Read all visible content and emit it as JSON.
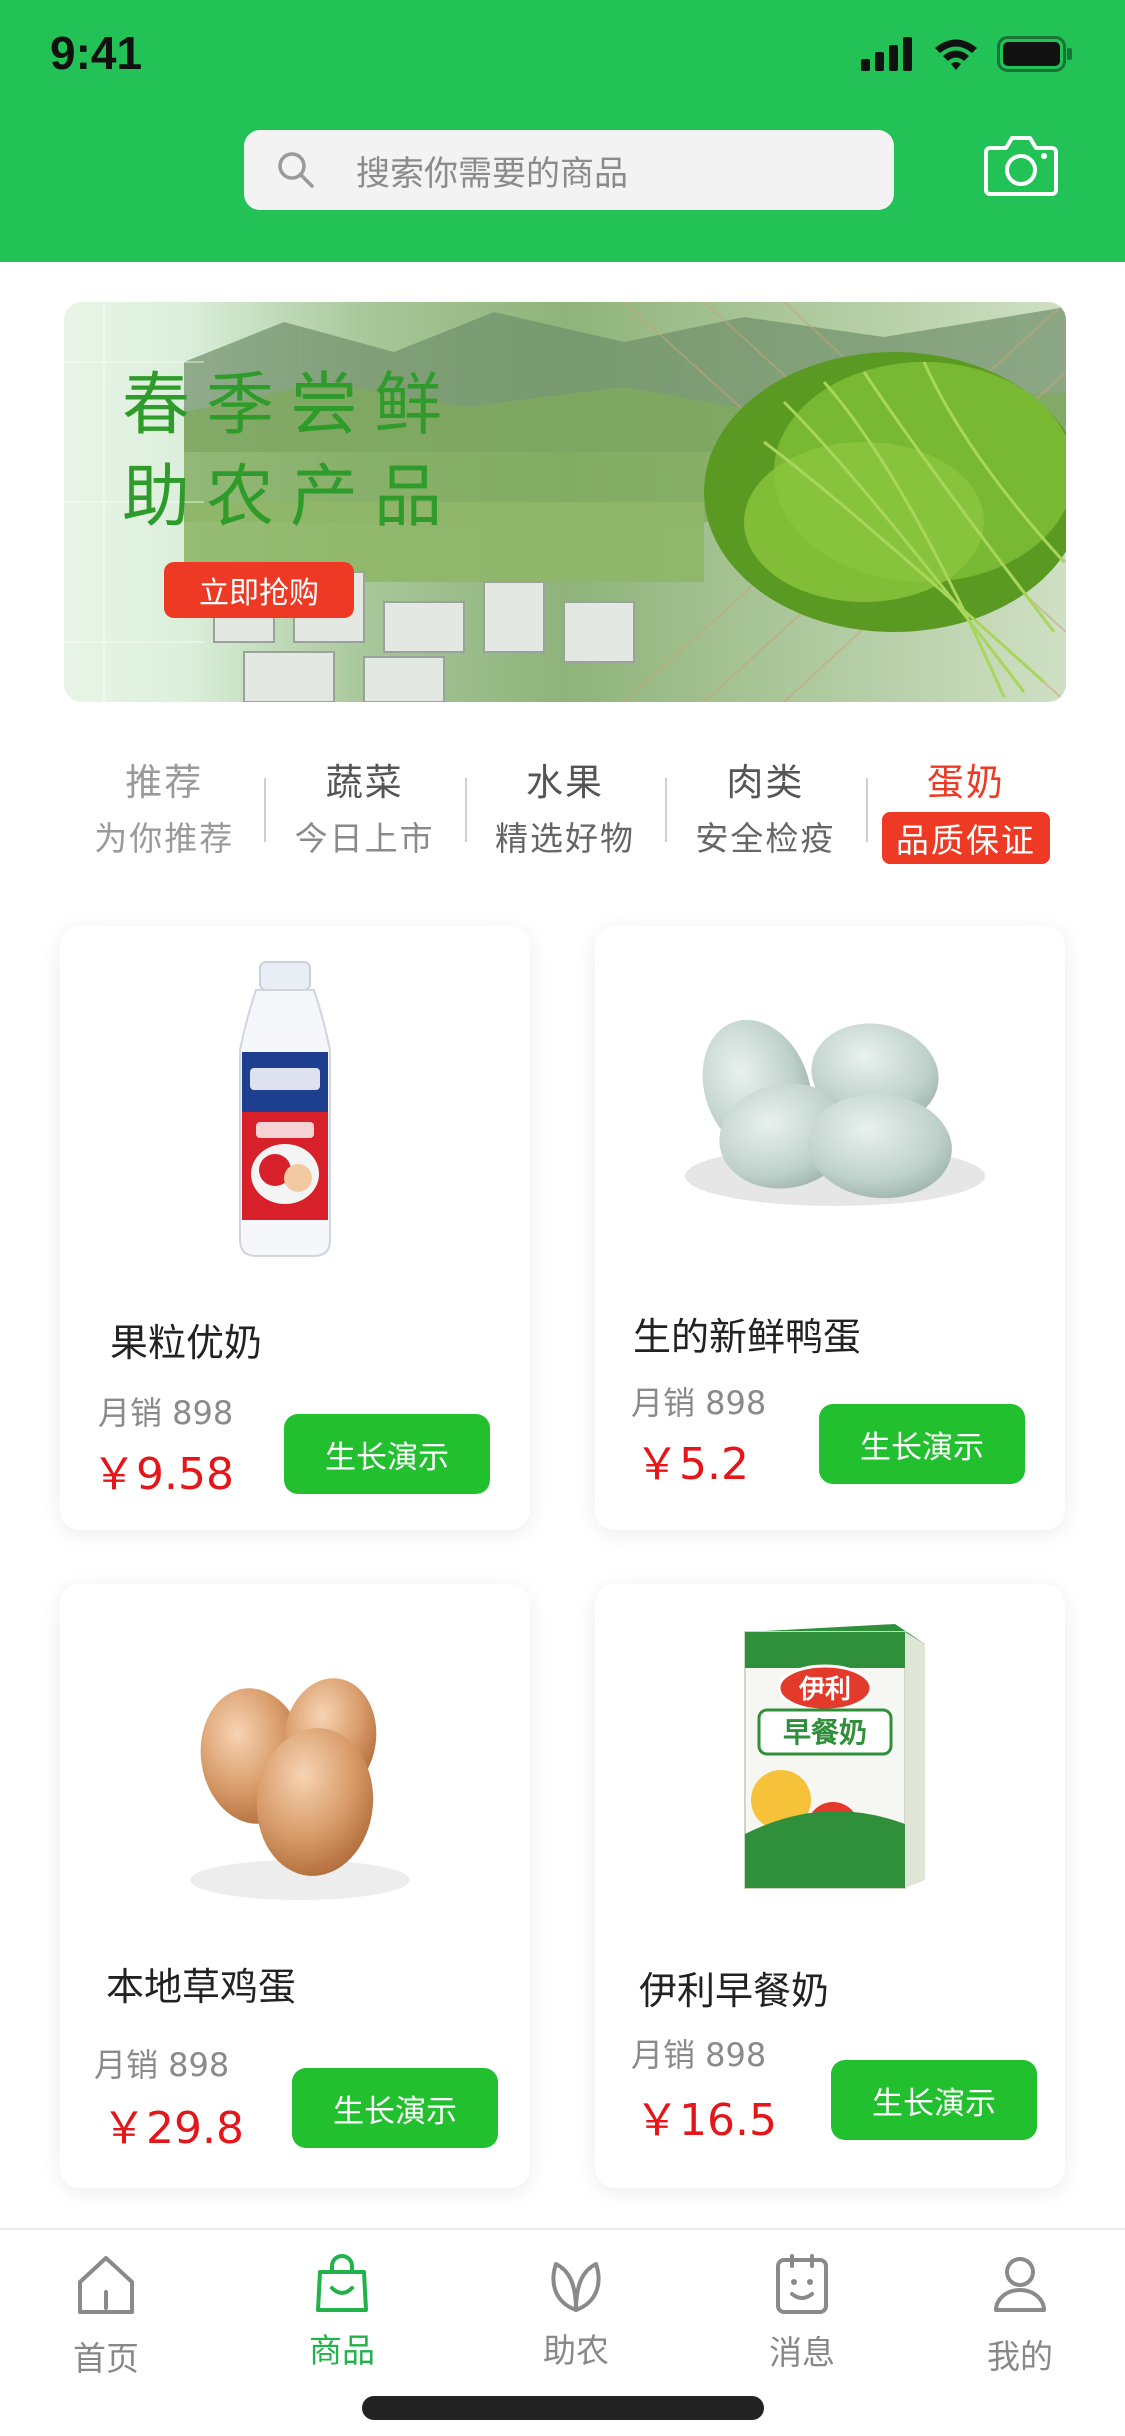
{
  "status_bar": {
    "time": "9:41"
  },
  "search": {
    "placeholder": "搜索你需要的商品"
  },
  "banner": {
    "title_line1": "春季尝鲜",
    "title_line2": "助农产品",
    "button_label": "立即抢购"
  },
  "categories": [
    {
      "title": "推荐",
      "subtitle": "为你推荐"
    },
    {
      "title": "蔬菜",
      "subtitle": "今日上市"
    },
    {
      "title": "水果",
      "subtitle": "精选好物"
    },
    {
      "title": "肉类",
      "subtitle": "安全检疫"
    },
    {
      "title": "蛋奶",
      "subtitle": "品质保证",
      "active": true
    }
  ],
  "products": [
    {
      "name": "果粒优奶",
      "sales": "月销 898",
      "price": "￥9.58",
      "button": "生长演示",
      "image": "yogurt-bottle"
    },
    {
      "name": "生的新鲜鸭蛋",
      "sales": "月销 898",
      "price": "￥5.2",
      "button": "生长演示",
      "image": "duck-eggs"
    },
    {
      "name": "本地草鸡蛋",
      "sales": "月销  898",
      "price": "￥29.8",
      "button": "生长演示",
      "image": "chicken-eggs"
    },
    {
      "name": "伊利早餐奶",
      "sales": "月销  898",
      "price": "￥16.5",
      "button": "生长演示",
      "image": "milk-carton",
      "brand_text": "伊利",
      "product_text": "早餐奶"
    }
  ],
  "tabbar": [
    {
      "label": "首页",
      "icon": "home-icon"
    },
    {
      "label": "商品",
      "icon": "shopping-bag-icon",
      "active": true
    },
    {
      "label": "助农",
      "icon": "leaf-icon"
    },
    {
      "label": "消息",
      "icon": "message-icon"
    },
    {
      "label": "我的",
      "icon": "profile-icon"
    }
  ],
  "colors": {
    "primary_green": "#22c256",
    "button_green": "#22c02f",
    "price_red": "#e5161a",
    "accent_red": "#ee3a24"
  }
}
